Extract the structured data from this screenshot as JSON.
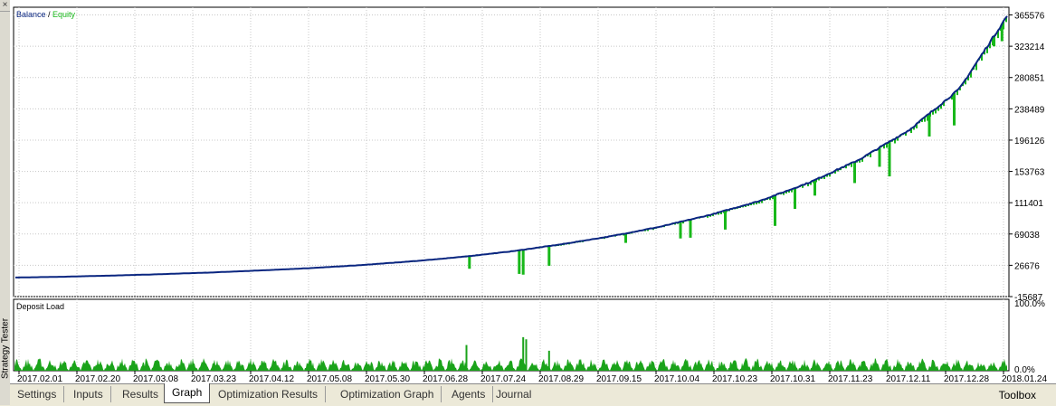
{
  "window": {
    "side_label": "Strategy Tester",
    "close_glyph": "×"
  },
  "colors": {
    "balance": "#0a2680",
    "equity": "#18b81a",
    "deposit_load": "#1aa31a",
    "grid": "#c8c8c8",
    "plot_bg": "#ffffff"
  },
  "chart_data": [
    {
      "type": "line",
      "legend": [
        "Balance",
        "Equity"
      ],
      "legend_placement": "top-left",
      "y_ticks": [
        365576,
        323214,
        280851,
        238489,
        196126,
        153763,
        111401,
        69038,
        26676,
        -15687
      ],
      "ylim": [
        -15687,
        376000
      ],
      "x_ticks": [
        "2017.02.01",
        "2017.02.20",
        "2017.03.08",
        "2017.03.23",
        "2017.04.12",
        "2017.05.08",
        "2017.05.30",
        "2017.06.28",
        "2017.07.24",
        "2017.08.29",
        "2017.09.15",
        "2017.10.04",
        "2017.10.23",
        "2017.10.31",
        "2017.11.23",
        "2017.12.11",
        "2017.12.28",
        "2018.01.24"
      ],
      "grid": true,
      "series": [
        {
          "name": "Balance",
          "x": [
            0,
            5,
            10,
            15,
            20,
            25,
            30,
            35,
            40,
            45,
            50,
            55,
            60,
            65,
            70,
            75,
            80,
            85,
            90,
            95,
            100
          ],
          "y": [
            10000,
            11200,
            12800,
            14700,
            17000,
            19800,
            23000,
            27000,
            32000,
            38000,
            45500,
            55000,
            66000,
            79000,
            95000,
            114000,
            139000,
            170000,
            210000,
            265000,
            368000
          ]
        },
        {
          "name": "Equity",
          "drawdowns": [
            {
              "x": 45.8,
              "y": 22000
            },
            {
              "x": 50.8,
              "y": 15000
            },
            {
              "x": 51.2,
              "y": 14000
            },
            {
              "x": 53.8,
              "y": 26000
            },
            {
              "x": 61.5,
              "y": 57000
            },
            {
              "x": 67.0,
              "y": 63000
            },
            {
              "x": 68.0,
              "y": 64000
            },
            {
              "x": 71.5,
              "y": 75000
            },
            {
              "x": 76.5,
              "y": 80000
            },
            {
              "x": 78.5,
              "y": 103000
            },
            {
              "x": 80.5,
              "y": 121000
            },
            {
              "x": 84.5,
              "y": 138000
            },
            {
              "x": 87.0,
              "y": 160000
            },
            {
              "x": 88.0,
              "y": 147000
            },
            {
              "x": 92.0,
              "y": 201000
            },
            {
              "x": 94.5,
              "y": 216000
            },
            {
              "x": 98.5,
              "y": 323000
            },
            {
              "x": 99.3,
              "y": 330000
            }
          ]
        }
      ]
    },
    {
      "type": "bar",
      "title": "Deposit Load",
      "y_ticks": [
        "100.0%",
        "0.0%"
      ],
      "ylim": [
        0,
        100
      ],
      "spikes": [
        {
          "x": 45.5,
          "value": 36
        },
        {
          "x": 51.2,
          "value": 47
        },
        {
          "x": 51.5,
          "value": 44
        },
        {
          "x": 53.8,
          "value": 28
        }
      ]
    }
  ],
  "tabs": [
    {
      "label": "Settings",
      "active": false
    },
    {
      "label": "Inputs",
      "active": false
    },
    {
      "label": "Results",
      "active": false
    },
    {
      "label": "Graph",
      "active": true
    },
    {
      "label": "Optimization Results",
      "active": false
    },
    {
      "label": "Optimization Graph",
      "active": false
    },
    {
      "label": "Agents",
      "active": false
    },
    {
      "label": "Journal",
      "active": false
    }
  ],
  "toolbox_label": "Toolbox"
}
